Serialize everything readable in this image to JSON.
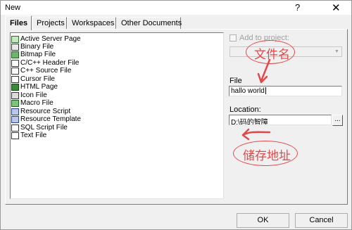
{
  "window": {
    "title": "New",
    "help_glyph": "?",
    "close_glyph": "✕"
  },
  "tabs": [
    {
      "label": "Files",
      "active": true
    },
    {
      "label": "Projects",
      "active": false
    },
    {
      "label": "Workspaces",
      "active": false
    },
    {
      "label": "Other Documents",
      "active": false
    }
  ],
  "file_types": [
    {
      "label": "Active Server Page",
      "icon": "asp-icon"
    },
    {
      "label": "Binary File",
      "icon": "binary-file-icon"
    },
    {
      "label": "Bitmap File",
      "icon": "bitmap-icon"
    },
    {
      "label": "C/C++ Header File",
      "icon": "header-file-icon"
    },
    {
      "label": "C++ Source File",
      "icon": "source-file-icon"
    },
    {
      "label": "Cursor File",
      "icon": "cursor-icon"
    },
    {
      "label": "HTML Page",
      "icon": "html-icon"
    },
    {
      "label": "Icon File",
      "icon": "icon-file-icon"
    },
    {
      "label": "Macro File",
      "icon": "macro-icon"
    },
    {
      "label": "Resource Script",
      "icon": "resource-script-icon"
    },
    {
      "label": "Resource Template",
      "icon": "resource-template-icon"
    },
    {
      "label": "SQL Script File",
      "icon": "sql-icon"
    },
    {
      "label": "Text File",
      "icon": "text-file-icon"
    }
  ],
  "add_to_project": {
    "label": "Add to project:",
    "checked": false,
    "enabled": false
  },
  "file_field": {
    "label": "File",
    "value": "hallo world"
  },
  "location_field": {
    "label": "Location:",
    "value": "D:\\码的智障",
    "browse_label": "..."
  },
  "annotations": {
    "file_name": "文件名",
    "storage_location": "储存地址",
    "color": "#e0494b"
  },
  "buttons": {
    "ok": "OK",
    "cancel": "Cancel"
  }
}
